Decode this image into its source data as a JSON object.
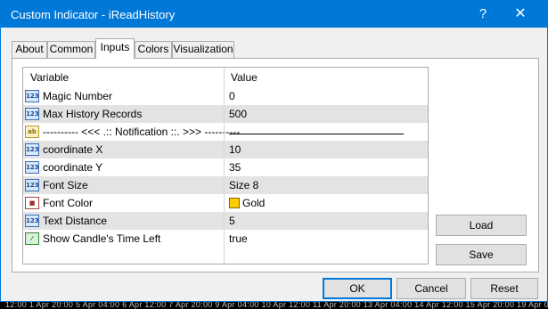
{
  "window": {
    "title": "Custom Indicator - iReadHistory",
    "help_glyph": "?",
    "close_glyph": "✕"
  },
  "tabs": [
    {
      "label": "About"
    },
    {
      "label": "Common"
    },
    {
      "label": "Inputs"
    },
    {
      "label": "Colors"
    },
    {
      "label": "Visualization"
    }
  ],
  "active_tab": "Inputs",
  "grid": {
    "col_variable": "Variable",
    "col_value": "Value",
    "rows": [
      {
        "icon": "123",
        "name": "Magic Number",
        "value": "0"
      },
      {
        "icon": "123",
        "name": "Max History Records",
        "value": "500"
      },
      {
        "icon": "ab",
        "name": "---------- <<< .:: Notification ::. >>> ----------",
        "value": ""
      },
      {
        "icon": "123",
        "name": "coordinate X",
        "value": "10"
      },
      {
        "icon": "123",
        "name": "coordinate Y",
        "value": "35"
      },
      {
        "icon": "123",
        "name": "Font Size",
        "value": "Size 8"
      },
      {
        "icon": "color",
        "name": "Font Color",
        "value": "Gold",
        "swatch": "#FFCC00"
      },
      {
        "icon": "123",
        "name": "Text Distance",
        "value": "5"
      },
      {
        "icon": "bool",
        "name": "Show Candle's Time Left",
        "value": "true"
      }
    ]
  },
  "side_buttons": {
    "load": "Load",
    "save": "Save"
  },
  "footer_buttons": {
    "ok": "OK",
    "cancel": "Cancel",
    "reset": "Reset"
  },
  "background_axis_text": "12:00   1 Apr 20:00    5 Apr 04:00    6 Apr 12:00    7 Apr 20:00    9 Apr 04:00    10 Apr 12:00   11 Apr 20:00   13 Apr 04:00   14 Apr 12:00   15 Apr 20:00   19 Apr 04:00   20 Apr 12:00   21 Apr 20:00"
}
